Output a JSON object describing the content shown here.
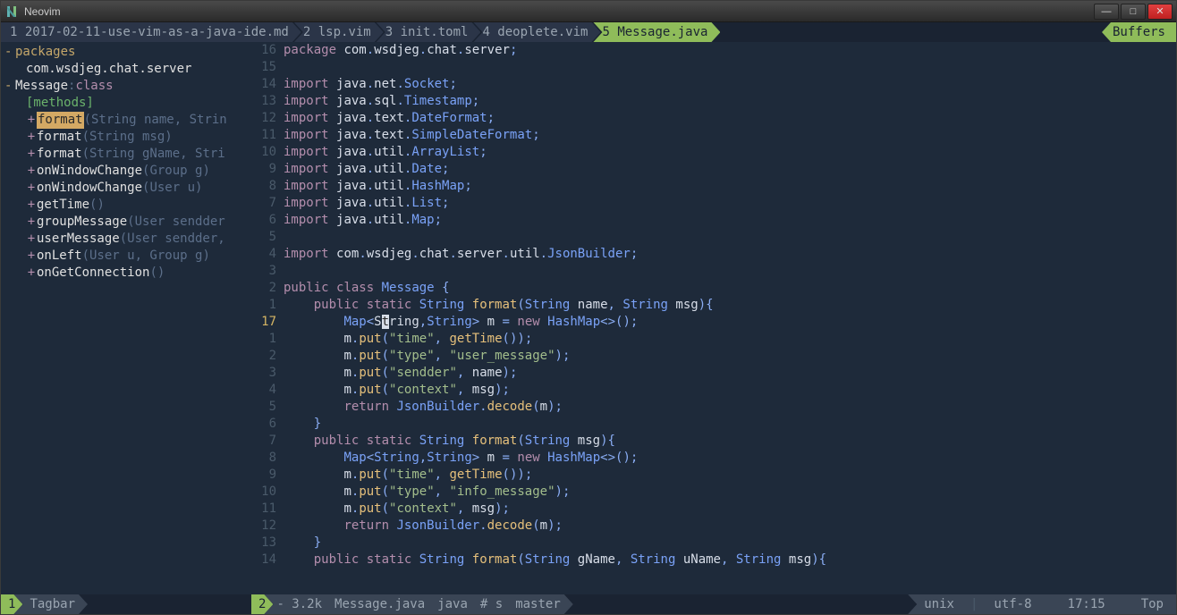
{
  "window": {
    "title": "Neovim"
  },
  "tabs": [
    {
      "label": "1 2017-02-11-use-vim-as-a-java-ide.md",
      "active": false
    },
    {
      "label": "2 lsp.vim",
      "active": false
    },
    {
      "label": "3 init.toml",
      "active": false
    },
    {
      "label": "4 deoplete.vim",
      "active": false
    },
    {
      "label": "5 Message.java",
      "active": true
    }
  ],
  "tab_buffers_label": "Buffers",
  "tagbar": {
    "packages_label": "packages",
    "package_name": "com.wsdjeg.chat.server",
    "class_label": "Message : class",
    "methods_label": "[methods]",
    "highlighted_method": "format",
    "methods": [
      {
        "sig_pre": "",
        "name": "format",
        "sig_post": "(String name, Strin",
        "hl": true
      },
      {
        "sig_pre": "",
        "name": "format",
        "sig_post": "(String msg)"
      },
      {
        "sig_pre": "",
        "name": "format",
        "sig_post": "(String gName, Stri"
      },
      {
        "sig_pre": "",
        "name": "onWindowChange",
        "sig_post": "(Group g)"
      },
      {
        "sig_pre": "",
        "name": "onWindowChange",
        "sig_post": "(User u)"
      },
      {
        "sig_pre": "",
        "name": "getTime",
        "sig_post": "()"
      },
      {
        "sig_pre": "",
        "name": "groupMessage",
        "sig_post": "(User sendder"
      },
      {
        "sig_pre": "",
        "name": "userMessage",
        "sig_post": "(User sendder,"
      },
      {
        "sig_pre": "",
        "name": "onLeft",
        "sig_post": "(User u, Group g)"
      },
      {
        "sig_pre": "",
        "name": "onGetConnection",
        "sig_post": "()"
      }
    ]
  },
  "editor": {
    "lines": [
      {
        "n": "16",
        "t": "package",
        "c": "package com.wsdjeg.chat.server;"
      },
      {
        "n": "15",
        "t": "blank",
        "c": ""
      },
      {
        "n": "14",
        "t": "import",
        "c": "import java.net.Socket;"
      },
      {
        "n": "13",
        "t": "import",
        "c": "import java.sql.Timestamp;"
      },
      {
        "n": "12",
        "t": "import",
        "c": "import java.text.DateFormat;"
      },
      {
        "n": "11",
        "t": "import",
        "c": "import java.text.SimpleDateFormat;"
      },
      {
        "n": "10",
        "t": "import",
        "c": "import java.util.ArrayList;"
      },
      {
        "n": "9",
        "t": "import",
        "c": "import java.util.Date;"
      },
      {
        "n": "8",
        "t": "import",
        "c": "import java.util.HashMap;"
      },
      {
        "n": "7",
        "t": "import",
        "c": "import java.util.List;"
      },
      {
        "n": "6",
        "t": "import",
        "c": "import java.util.Map;"
      },
      {
        "n": "5",
        "t": "blank",
        "c": ""
      },
      {
        "n": "4",
        "t": "import",
        "c": "import com.wsdjeg.chat.server.util.JsonBuilder;"
      },
      {
        "n": "3",
        "t": "blank",
        "c": ""
      },
      {
        "n": "2",
        "t": "classdef",
        "c": "public class Message {"
      },
      {
        "n": "1",
        "t": "methoddef",
        "c": "    public static String format(String name, String msg){"
      },
      {
        "n": "17",
        "t": "cursor",
        "c": "        Map<String,String> m = new HashMap<>();",
        "cursorCol": 13
      },
      {
        "n": "1",
        "t": "put",
        "c": "        m.put(\"time\", getTime());"
      },
      {
        "n": "2",
        "t": "put",
        "c": "        m.put(\"type\", \"user_message\");"
      },
      {
        "n": "3",
        "t": "put",
        "c": "        m.put(\"sendder\", name);"
      },
      {
        "n": "4",
        "t": "put",
        "c": "        m.put(\"context\", msg);"
      },
      {
        "n": "5",
        "t": "return",
        "c": "        return JsonBuilder.decode(m);"
      },
      {
        "n": "6",
        "t": "brace",
        "c": "    }"
      },
      {
        "n": "7",
        "t": "methoddef",
        "c": "    public static String format(String msg){"
      },
      {
        "n": "8",
        "t": "map",
        "c": "        Map<String,String> m = new HashMap<>();"
      },
      {
        "n": "9",
        "t": "put",
        "c": "        m.put(\"time\", getTime());"
      },
      {
        "n": "10",
        "t": "put",
        "c": "        m.put(\"type\", \"info_message\");"
      },
      {
        "n": "11",
        "t": "put",
        "c": "        m.put(\"context\", msg);"
      },
      {
        "n": "12",
        "t": "return",
        "c": "        return JsonBuilder.decode(m);"
      },
      {
        "n": "13",
        "t": "brace",
        "c": "    }"
      },
      {
        "n": "14",
        "t": "methoddef",
        "c": "    public static String format(String gName, String uName, String msg){"
      }
    ]
  },
  "status_left": {
    "num": "1",
    "name": "Tagbar"
  },
  "status_main": {
    "num": "2",
    "size": "- 3.2k",
    "filename": "Message.java",
    "filetype": "java",
    "hunk": "# s",
    "branch": "master"
  },
  "status_right": {
    "fileformat": "unix",
    "encoding": "utf-8",
    "position": "17:15",
    "scroll": "Top"
  }
}
